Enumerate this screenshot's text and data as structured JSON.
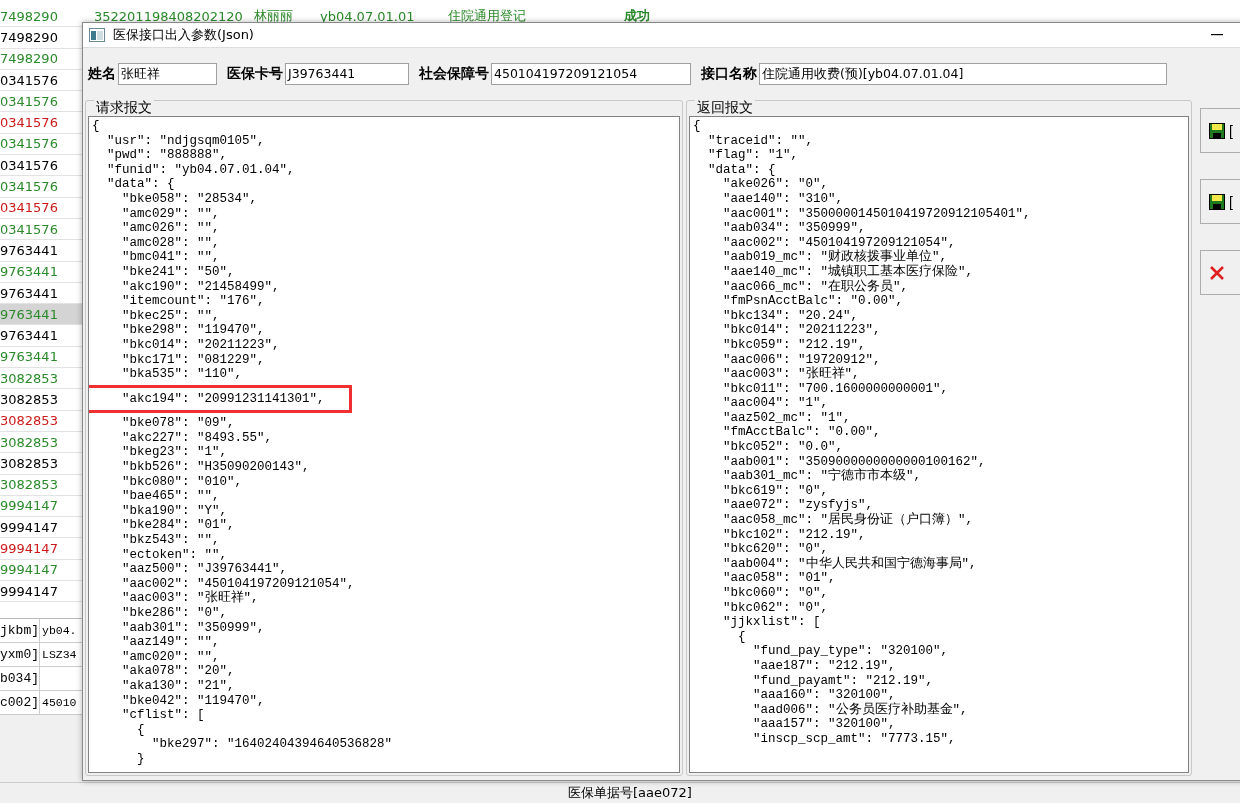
{
  "background_table": {
    "top_row_cells": [
      "352201198408202120",
      "林丽丽",
      "yb04.07.01.01",
      "住院通用登记",
      "成功"
    ],
    "rows": [
      {
        "text": "7498290",
        "color": "#2a8a2a",
        "selected": false
      },
      {
        "text": "7498290",
        "color": "#000000",
        "selected": false
      },
      {
        "text": "7498290",
        "color": "#2a8a2a",
        "selected": false
      },
      {
        "text": "0341576",
        "color": "#000000",
        "selected": false
      },
      {
        "text": "0341576",
        "color": "#2a8a2a",
        "selected": false
      },
      {
        "text": "0341576",
        "color": "#cc1a1a",
        "selected": false
      },
      {
        "text": "0341576",
        "color": "#2a8a2a",
        "selected": false
      },
      {
        "text": "0341576",
        "color": "#000000",
        "selected": false
      },
      {
        "text": "0341576",
        "color": "#2a8a2a",
        "selected": false
      },
      {
        "text": "0341576",
        "color": "#cc1a1a",
        "selected": false
      },
      {
        "text": "0341576",
        "color": "#2a8a2a",
        "selected": false
      },
      {
        "text": "9763441",
        "color": "#000000",
        "selected": false
      },
      {
        "text": "9763441",
        "color": "#2a8a2a",
        "selected": false
      },
      {
        "text": "9763441",
        "color": "#000000",
        "selected": false
      },
      {
        "text": "9763441",
        "color": "#2a8a2a",
        "selected": true
      },
      {
        "text": "9763441",
        "color": "#000000",
        "selected": false
      },
      {
        "text": "9763441",
        "color": "#2a8a2a",
        "selected": false
      },
      {
        "text": "3082853",
        "color": "#2a8a2a",
        "selected": false
      },
      {
        "text": "3082853",
        "color": "#000000",
        "selected": false
      },
      {
        "text": "3082853",
        "color": "#cc1a1a",
        "selected": false
      },
      {
        "text": "3082853",
        "color": "#2a8a2a",
        "selected": false
      },
      {
        "text": "3082853",
        "color": "#000000",
        "selected": false
      },
      {
        "text": "3082853",
        "color": "#2a8a2a",
        "selected": false
      },
      {
        "text": "9994147",
        "color": "#2a8a2a",
        "selected": false
      },
      {
        "text": "9994147",
        "color": "#000000",
        "selected": false
      },
      {
        "text": "9994147",
        "color": "#cc1a1a",
        "selected": false
      },
      {
        "text": "9994147",
        "color": "#2a8a2a",
        "selected": false
      },
      {
        "text": "9994147",
        "color": "#000000",
        "selected": false
      }
    ],
    "fields": [
      {
        "label": "jkbm]",
        "value": "yb04."
      },
      {
        "label": "yxm0]",
        "value": "LSZ34"
      },
      {
        "label": "b034]"
      },
      {
        "label": "c002]",
        "value": "45010"
      }
    ],
    "footer": [
      "医保单据号[aae072]"
    ]
  },
  "dialog": {
    "title": "医保接口出入参数(Json)",
    "header_fields": [
      {
        "label": "姓名",
        "value": "张旺祥"
      },
      {
        "label": "医保卡号",
        "value": "J39763441"
      },
      {
        "label": "社会保障号",
        "value": "450104197209121054"
      },
      {
        "label": "接口名称",
        "value": "住院通用收费(预)[yb04.07.01.04]"
      }
    ],
    "request": {
      "title": "请求报文",
      "lines": [
        {
          "text": "{",
          "highlighted": false
        },
        {
          "text": "  \"usr\": \"ndjgsqm0105\",",
          "highlighted": false
        },
        {
          "text": "  \"pwd\": \"888888\",",
          "highlighted": false
        },
        {
          "text": "  \"funid\": \"yb04.07.01.04\",",
          "highlighted": false
        },
        {
          "text": "  \"data\": {",
          "highlighted": false
        },
        {
          "text": "    \"bke058\": \"28534\",",
          "highlighted": false
        },
        {
          "text": "    \"amc029\": \"\",",
          "highlighted": false
        },
        {
          "text": "    \"amc026\": \"\",",
          "highlighted": false
        },
        {
          "text": "    \"amc028\": \"\",",
          "highlighted": false
        },
        {
          "text": "    \"bmc041\": \"\",",
          "highlighted": false
        },
        {
          "text": "    \"bke241\": \"50\",",
          "highlighted": false
        },
        {
          "text": "    \"akc190\": \"21458499\",",
          "highlighted": false
        },
        {
          "text": "    \"itemcount\": \"176\",",
          "highlighted": false
        },
        {
          "text": "    \"bkec25\": \"\",",
          "highlighted": false
        },
        {
          "text": "    \"bke298\": \"119470\",",
          "highlighted": false
        },
        {
          "text": "    \"bkc014\": \"20211223\",",
          "highlighted": false
        },
        {
          "text": "    \"bkc171\": \"081229\",",
          "highlighted": false
        },
        {
          "text": "    \"bka535\": \"110\",",
          "highlighted": false
        },
        {
          "text": "    \"akc194\": \"20991231141301\",",
          "highlighted": true
        },
        {
          "text": "    \"bke078\": \"09\",",
          "highlighted": false
        },
        {
          "text": "    \"akc227\": \"8493.55\",",
          "highlighted": false
        },
        {
          "text": "    \"bkeg23\": \"1\",",
          "highlighted": false
        },
        {
          "text": "    \"bkb526\": \"H35090200143\",",
          "highlighted": false
        },
        {
          "text": "    \"bkc080\": \"010\",",
          "highlighted": false
        },
        {
          "text": "    \"bae465\": \"\",",
          "highlighted": false
        },
        {
          "text": "    \"bka190\": \"Y\",",
          "highlighted": false
        },
        {
          "text": "    \"bke284\": \"01\",",
          "highlighted": false
        },
        {
          "text": "    \"bkz543\": \"\",",
          "highlighted": false
        },
        {
          "text": "    \"ectoken\": \"\",",
          "highlighted": false
        },
        {
          "text": "    \"aaz500\": \"J39763441\",",
          "highlighted": false
        },
        {
          "text": "    \"aac002\": \"450104197209121054\",",
          "highlighted": false
        },
        {
          "text": "    \"aac003\": \"张旺祥\",",
          "highlighted": false
        },
        {
          "text": "    \"bke286\": \"0\",",
          "highlighted": false
        },
        {
          "text": "    \"aab301\": \"350999\",",
          "highlighted": false
        },
        {
          "text": "    \"aaz149\": \"\",",
          "highlighted": false
        },
        {
          "text": "    \"amc020\": \"\",",
          "highlighted": false
        },
        {
          "text": "    \"aka078\": \"20\",",
          "highlighted": false
        },
        {
          "text": "    \"aka130\": \"21\",",
          "highlighted": false
        },
        {
          "text": "    \"bke042\": \"119470\",",
          "highlighted": false
        },
        {
          "text": "    \"cflist\": [",
          "highlighted": false
        },
        {
          "text": "      {",
          "highlighted": false
        },
        {
          "text": "        \"bke297\": \"16402404394640536828\"",
          "highlighted": false
        },
        {
          "text": "      }",
          "highlighted": false
        }
      ]
    },
    "response": {
      "title": "返回报文",
      "lines": [
        "{",
        "  \"traceid\": \"\",",
        "  \"flag\": \"1\",",
        "  \"data\": {",
        "    \"ake026\": \"0\",",
        "    \"aae140\": \"310\",",
        "    \"aac001\": \"3500000145010419720912105401\",",
        "    \"aab034\": \"350999\",",
        "    \"aac002\": \"450104197209121054\",",
        "    \"aab019_mc\": \"财政核拨事业单位\",",
        "    \"aae140_mc\": \"城镇职工基本医疗保险\",",
        "    \"aac066_mc\": \"在职公务员\",",
        "    \"fmPsnAcctBalc\": \"0.00\",",
        "    \"bkc134\": \"20.24\",",
        "    \"bkc014\": \"20211223\",",
        "    \"bkc059\": \"212.19\",",
        "    \"aac006\": \"19720912\",",
        "    \"aac003\": \"张旺祥\",",
        "    \"bkc011\": \"700.1600000000001\",",
        "    \"aac004\": \"1\",",
        "    \"aaz502_mc\": \"1\",",
        "    \"fmAcctBalc\": \"0.00\",",
        "    \"bkc052\": \"0.0\",",
        "    \"aab001\": \"3509000000000000100162\",",
        "    \"aab301_mc\": \"宁德市市本级\",",
        "    \"bkc619\": \"0\",",
        "    \"aae072\": \"zysfyjs\",",
        "    \"aac058_mc\": \"居民身份证（户口簿）\",",
        "    \"bkc102\": \"212.19\",",
        "    \"bkc620\": \"0\",",
        "    \"aab004\": \"中华人民共和国宁德海事局\",",
        "    \"aac058\": \"01\",",
        "    \"bkc060\": \"0\",",
        "    \"bkc062\": \"0\",",
        "    \"jjkxlist\": [",
        "      {",
        "        \"fund_pay_type\": \"320100\",",
        "        \"aae187\": \"212.19\",",
        "        \"fund_payamt\": \"212.19\",",
        "        \"aaa160\": \"320100\",",
        "        \"aad006\": \"公务员医疗补助基金\",",
        "        \"aaa157\": \"320100\",",
        "        \"inscp_scp_amt\": \"7773.15\","
      ]
    },
    "side_buttons": [
      {
        "kind": "save",
        "label": "["
      },
      {
        "kind": "save",
        "label": "["
      },
      {
        "kind": "delete"
      }
    ]
  }
}
